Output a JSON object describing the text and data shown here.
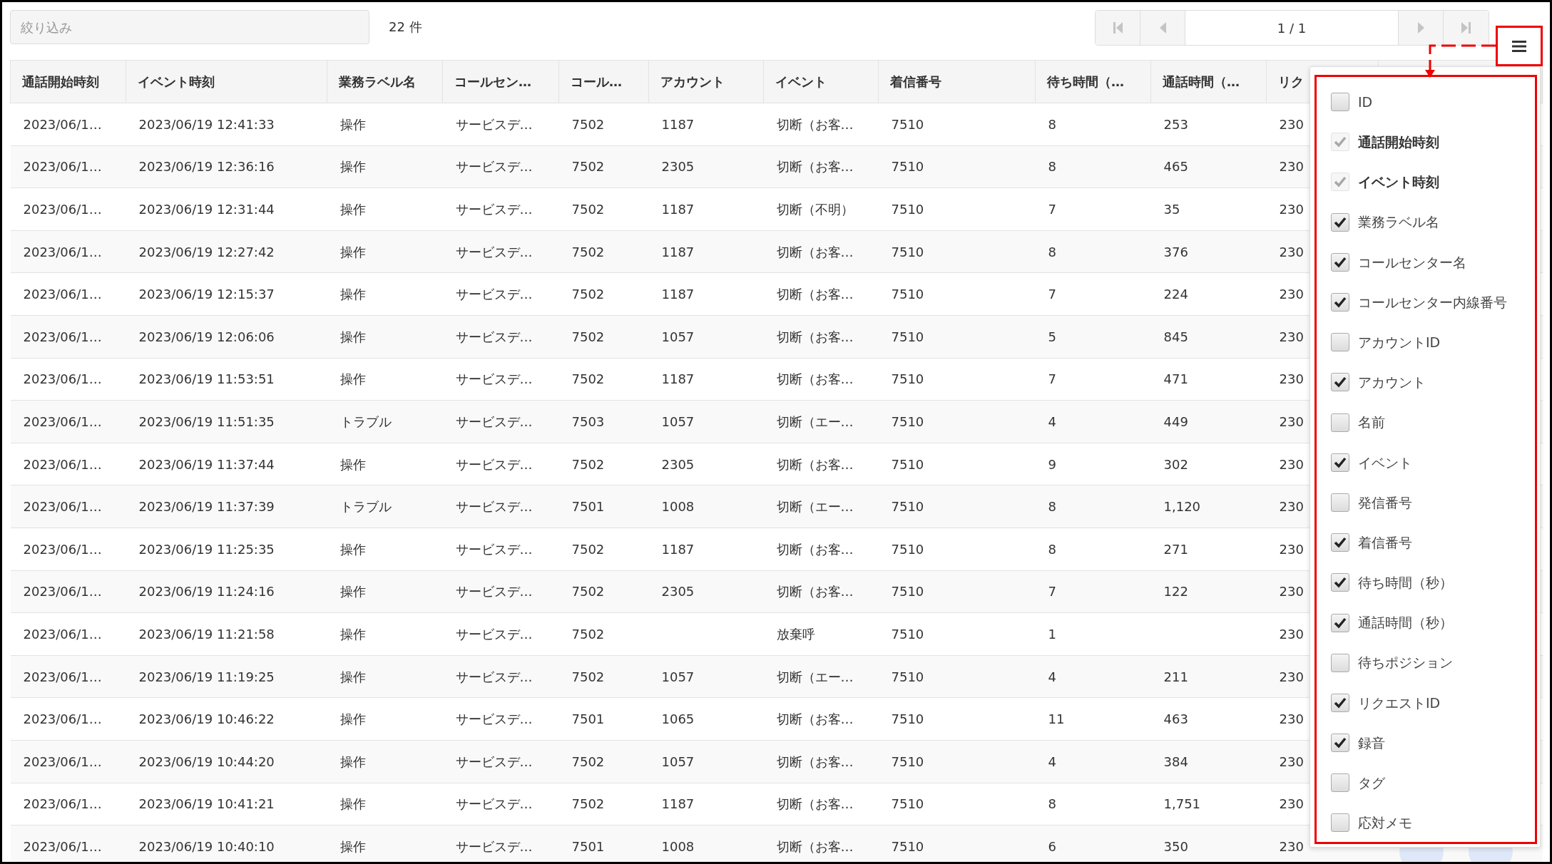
{
  "filter": {
    "placeholder": "絞り込み"
  },
  "count": "22 件",
  "pagination": {
    "page": "1 / 1",
    "buttons": [
      {
        "kind": "first",
        "disabled": true
      },
      {
        "kind": "prev",
        "disabled": true
      },
      {
        "kind": "next",
        "disabled": true
      },
      {
        "kind": "last",
        "disabled": true
      }
    ]
  },
  "table": {
    "columns": [
      "通話開始時刻",
      "イベント時刻",
      "業務ラベル名",
      "コールセン…",
      "コール…",
      "アカウント",
      "イベント",
      "着信番号",
      "待ち時間（…",
      "通話時間（…",
      "リク"
    ],
    "rows": [
      [
        "2023/06/1…",
        "2023/06/19 12:41:33",
        "操作",
        "サービスデ…",
        "7502",
        "1187",
        "切断（お客…",
        "7510",
        "8",
        "253",
        "230"
      ],
      [
        "2023/06/1…",
        "2023/06/19 12:36:16",
        "操作",
        "サービスデ…",
        "7502",
        "2305",
        "切断（お客…",
        "7510",
        "8",
        "465",
        "230"
      ],
      [
        "2023/06/1…",
        "2023/06/19 12:31:44",
        "操作",
        "サービスデ…",
        "7502",
        "1187",
        "切断（不明）",
        "7510",
        "7",
        "35",
        "230"
      ],
      [
        "2023/06/1…",
        "2023/06/19 12:27:42",
        "操作",
        "サービスデ…",
        "7502",
        "1187",
        "切断（お客…",
        "7510",
        "8",
        "376",
        "230"
      ],
      [
        "2023/06/1…",
        "2023/06/19 12:15:37",
        "操作",
        "サービスデ…",
        "7502",
        "1187",
        "切断（お客…",
        "7510",
        "7",
        "224",
        "230"
      ],
      [
        "2023/06/1…",
        "2023/06/19 12:06:06",
        "操作",
        "サービスデ…",
        "7502",
        "1057",
        "切断（お客…",
        "7510",
        "5",
        "845",
        "230"
      ],
      [
        "2023/06/1…",
        "2023/06/19 11:53:51",
        "操作",
        "サービスデ…",
        "7502",
        "1187",
        "切断（お客…",
        "7510",
        "7",
        "471",
        "230"
      ],
      [
        "2023/06/1…",
        "2023/06/19 11:51:35",
        "トラブル",
        "サービスデ…",
        "7503",
        "1057",
        "切断（エー…",
        "7510",
        "4",
        "449",
        "230"
      ],
      [
        "2023/06/1…",
        "2023/06/19 11:37:44",
        "操作",
        "サービスデ…",
        "7502",
        "2305",
        "切断（お客…",
        "7510",
        "9",
        "302",
        "230"
      ],
      [
        "2023/06/1…",
        "2023/06/19 11:37:39",
        "トラブル",
        "サービスデ…",
        "7501",
        "1008",
        "切断（エー…",
        "7510",
        "8",
        "1,120",
        "230"
      ],
      [
        "2023/06/1…",
        "2023/06/19 11:25:35",
        "操作",
        "サービスデ…",
        "7502",
        "1187",
        "切断（お客…",
        "7510",
        "8",
        "271",
        "230"
      ],
      [
        "2023/06/1…",
        "2023/06/19 11:24:16",
        "操作",
        "サービスデ…",
        "7502",
        "2305",
        "切断（お客…",
        "7510",
        "7",
        "122",
        "230"
      ],
      [
        "2023/06/1…",
        "2023/06/19 11:21:58",
        "操作",
        "サービスデ…",
        "7502",
        null,
        "放棄呼",
        "7510",
        "1",
        null,
        "230"
      ],
      [
        "2023/06/1…",
        "2023/06/19 11:19:25",
        "操作",
        "サービスデ…",
        "7502",
        "1057",
        "切断（エー…",
        "7510",
        "4",
        "211",
        "230"
      ],
      [
        "2023/06/1…",
        "2023/06/19 10:46:22",
        "操作",
        "サービスデ…",
        "7501",
        "1065",
        "切断（お客…",
        "7510",
        "11",
        "463",
        "230"
      ],
      [
        "2023/06/1…",
        "2023/06/19 10:44:20",
        "操作",
        "サービスデ…",
        "7502",
        "1057",
        "切断（お客…",
        "7510",
        "4",
        "384",
        "230"
      ],
      [
        "2023/06/1…",
        "2023/06/19 10:41:21",
        "操作",
        "サービスデ…",
        "7502",
        "1187",
        "切断（お客…",
        "7510",
        "8",
        "1,751",
        "230"
      ],
      [
        "2023/06/1…",
        "2023/06/19 10:40:10",
        "操作",
        "サービスデ…",
        "7501",
        "1008",
        "切断（お客…",
        "7510",
        "6",
        "350",
        "230"
      ]
    ]
  },
  "column_menu": {
    "items": [
      {
        "label": "ID",
        "checked": false,
        "disabled": false
      },
      {
        "label": "通話開始時刻",
        "checked": true,
        "disabled": true
      },
      {
        "label": "イベント時刻",
        "checked": true,
        "disabled": true
      },
      {
        "label": "業務ラベル名",
        "checked": true,
        "disabled": false
      },
      {
        "label": "コールセンター名",
        "checked": true,
        "disabled": false
      },
      {
        "label": "コールセンター内線番号",
        "checked": true,
        "disabled": false
      },
      {
        "label": "アカウントID",
        "checked": false,
        "disabled": false
      },
      {
        "label": "アカウント",
        "checked": true,
        "disabled": false
      },
      {
        "label": "名前",
        "checked": false,
        "disabled": false
      },
      {
        "label": "イベント",
        "checked": true,
        "disabled": false
      },
      {
        "label": "発信番号",
        "checked": false,
        "disabled": false
      },
      {
        "label": "着信番号",
        "checked": true,
        "disabled": false
      },
      {
        "label": "待ち時間（秒）",
        "checked": true,
        "disabled": false
      },
      {
        "label": "通話時間（秒）",
        "checked": true,
        "disabled": false
      },
      {
        "label": "待ちポジション",
        "checked": false,
        "disabled": false
      },
      {
        "label": "リクエストID",
        "checked": true,
        "disabled": false
      },
      {
        "label": "録音",
        "checked": true,
        "disabled": false
      },
      {
        "label": "タグ",
        "checked": false,
        "disabled": false
      },
      {
        "label": "応対メモ",
        "checked": false,
        "disabled": false
      }
    ]
  }
}
